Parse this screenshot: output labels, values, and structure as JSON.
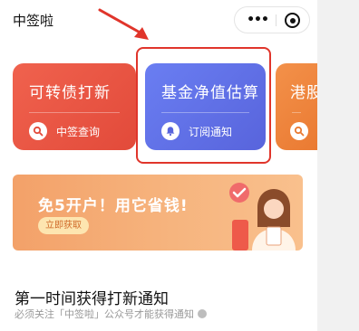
{
  "nav": {
    "title": "中签啦"
  },
  "cards": [
    {
      "title": "可转债打新",
      "action": "中签查询",
      "icon": "search-icon",
      "color": "#e9533f"
    },
    {
      "title": "基金净值估算",
      "action": "订阅通知",
      "icon": "bell-icon",
      "color": "#5f6fe6"
    },
    {
      "title": "港股",
      "icon": "search-icon",
      "color": "#ef8640"
    }
  ],
  "banner": {
    "headline": "免5开户！用它省钱!",
    "button": "立即获取"
  },
  "section": {
    "title": "第一时间获得打新通知",
    "subtitle": "必须关注「中签啦」公众号才能获得通知"
  },
  "colors": {
    "highlight": "#e0352b",
    "arrow": "#e0352b"
  }
}
